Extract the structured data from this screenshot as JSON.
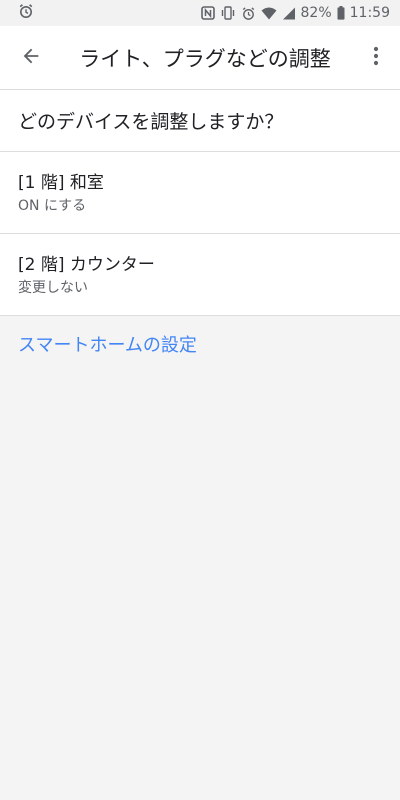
{
  "status_bar": {
    "battery": "82%",
    "time": "11:59",
    "icons": [
      "alarm-icon",
      "nfc-icon",
      "vibrate-icon",
      "alarm-icon",
      "wifi-icon",
      "signal-icon",
      "battery-icon"
    ]
  },
  "app_bar": {
    "title": "ライト、プラグなどの調整",
    "back_icon": "arrow-back-icon",
    "more_icon": "more-vert-icon"
  },
  "main": {
    "question": "どのデバイスを調整しますか？",
    "devices": [
      {
        "name": "[1 階] 和室",
        "status": "ON にする"
      },
      {
        "name": "[2 階] カウンター",
        "status": "変更しない"
      }
    ],
    "settings_link": "スマートホームの設定"
  },
  "colors": {
    "accent": "#4285f4",
    "background": "#f4f4f4",
    "surface": "#ffffff"
  }
}
